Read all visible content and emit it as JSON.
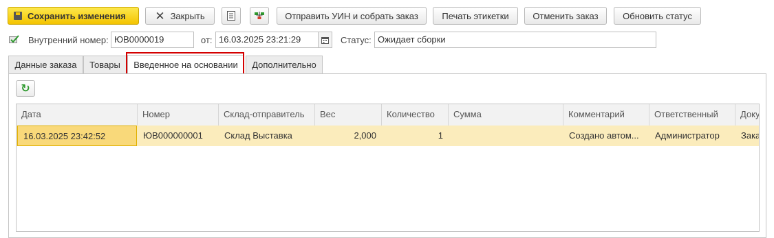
{
  "toolbar": {
    "save_label": "Сохранить изменения",
    "close_label": "Закрыть",
    "send_label": "Отправить УИН и собрать заказ",
    "print_label": "Печать этикетки",
    "cancel_label": "Отменить заказ",
    "update_label": "Обновить статус"
  },
  "header": {
    "internal_number_label": "Внутренний номер:",
    "internal_number_value": "ЮВ0000019",
    "date_label": "от:",
    "date_value": "16.03.2025 23:21:29",
    "status_label": "Статус:",
    "status_value": "Ожидает сборки"
  },
  "tabs": [
    {
      "label": "Данные заказа"
    },
    {
      "label": "Товары"
    },
    {
      "label": "Введенное на основании"
    },
    {
      "label": "Дополнительно"
    }
  ],
  "table": {
    "columns": [
      "Дата",
      "Номер",
      "Склад-отправитель",
      "Вес",
      "Количество",
      "Сумма",
      "Комментарий",
      "Ответственный",
      "Доку"
    ],
    "rows": [
      {
        "date": "16.03.2025 23:42:52",
        "number": "ЮВ000000001",
        "warehouse": "Склад Выставка",
        "weight": "2,000",
        "quantity": "1",
        "sum": "",
        "comment": "Создано автом...",
        "responsible": "Администратор",
        "document": "Зака"
      }
    ]
  },
  "colors": {
    "accent_yellow": "#f4c400",
    "row_highlight": "#fbecbc",
    "tab_highlight_border": "#d40000",
    "refresh_green": "#2e9a2e"
  }
}
